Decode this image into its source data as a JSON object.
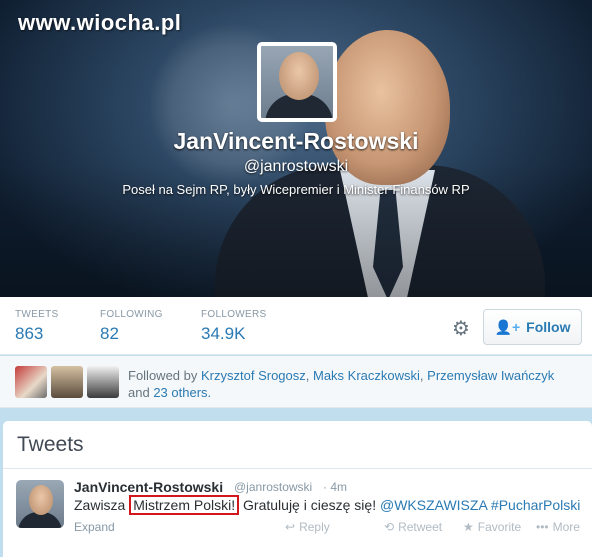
{
  "watermark": "www.wiocha.pl",
  "profile": {
    "name": "JanVincent-Rostowski",
    "handle": "@janrostowski",
    "bio": "Poseł na Sejm RP, były Wicepremier i Minister Finansów RP"
  },
  "stats": [
    {
      "label": "TWEETS",
      "value": "863"
    },
    {
      "label": "FOLLOWING",
      "value": "82"
    },
    {
      "label": "FOLLOWERS",
      "value": "34.9K"
    }
  ],
  "follow_button": {
    "label": "Follow",
    "icon": "add-user-icon"
  },
  "settings_icon": "gear-icon",
  "followed_by": {
    "prefix": "Followed by",
    "names": [
      "Krzysztof Srogosz",
      "Maks Kraczkowski",
      "Przemysław Iwańczyk"
    ],
    "and_text": "and",
    "others": "23 others."
  },
  "tweets_section": {
    "title": "Tweets"
  },
  "tweet": {
    "author": "JanVincent-Rostowski",
    "handle": "@janrostowski",
    "dot": "·",
    "time": "4m",
    "text_before": "Zawisza ",
    "text_highlight": "Mistrzem Polski!",
    "text_after": " Gratuluję i cieszę się! ",
    "mention": "@WKSZAWISZA",
    "hashtag": "#PucharPolski",
    "expand": "Expand",
    "actions": {
      "reply": "Reply",
      "retweet": "Retweet",
      "favorite": "Favorite",
      "more": "More"
    }
  },
  "colors": {
    "link": "#2a7ab3",
    "highlight_border": "#d3161b",
    "page_bg": "#c0deed"
  }
}
